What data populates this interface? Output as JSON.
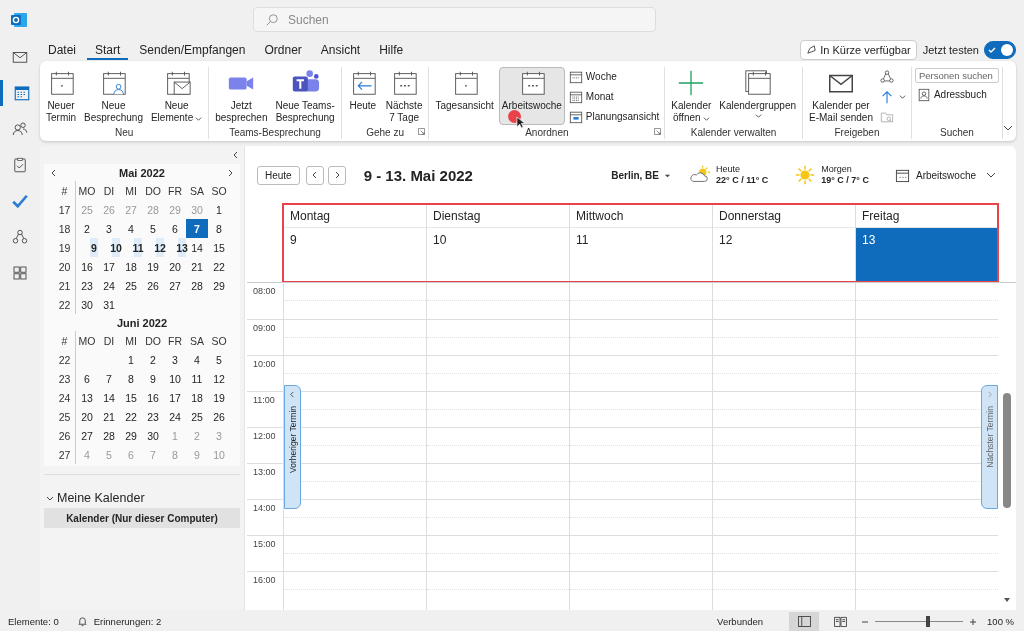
{
  "search": {
    "placeholder": "Suchen"
  },
  "nav_rail": [
    {
      "selected": false
    },
    {
      "selected": true
    },
    {
      "selected": false
    },
    {
      "selected": false
    },
    {
      "selected": false
    },
    {
      "selected": false
    },
    {
      "selected": false
    }
  ],
  "menu_tabs": [
    {
      "label": "Datei",
      "selected": false
    },
    {
      "label": "Start",
      "selected": true
    },
    {
      "label": "Senden/Empfangen",
      "selected": false
    },
    {
      "label": "Ordner",
      "selected": false
    },
    {
      "label": "Ansicht",
      "selected": false
    },
    {
      "label": "Hilfe",
      "selected": false
    }
  ],
  "coming_soon": {
    "label": "In Kürze verfügbar"
  },
  "try_now": {
    "label": "Jetzt testen",
    "on": true
  },
  "ribbon": [
    {
      "label": "Neu",
      "items": [
        {
          "kind": "large",
          "lines": [
            "Neuer",
            "Termin"
          ],
          "dropdown": false
        },
        {
          "kind": "large",
          "lines": [
            "Neue",
            "Besprechung"
          ],
          "dropdown": false
        },
        {
          "kind": "large",
          "lines": [
            "Neue",
            "Elemente"
          ],
          "dropdown": true
        }
      ]
    },
    {
      "label": "Teams-Besprechung",
      "items": [
        {
          "kind": "large",
          "lines": [
            "Jetzt",
            "besprechen"
          ]
        },
        {
          "kind": "large",
          "lines": [
            "Neue Teams-",
            "Besprechung"
          ]
        }
      ]
    },
    {
      "label": "Gehe zu",
      "launcher": true,
      "items": [
        {
          "kind": "large",
          "lines": [
            "Heute"
          ]
        },
        {
          "kind": "large",
          "lines": [
            "Nächste",
            "7 Tage"
          ]
        }
      ]
    },
    {
      "label": "Anordnen",
      "launcher": true,
      "items": [
        {
          "kind": "large",
          "lines": [
            "Tagesansicht"
          ],
          "selected": false
        },
        {
          "kind": "large",
          "lines": [
            "Arbeitswoche"
          ],
          "selected": true
        },
        {
          "kind": "small",
          "lines": [
            "Woche"
          ],
          "selected": false
        },
        {
          "kind": "small",
          "lines": [
            "Monat"
          ],
          "selected": false
        },
        {
          "kind": "small",
          "lines": [
            "Planungsansicht"
          ],
          "selected": false
        }
      ]
    },
    {
      "label": "Kalender verwalten",
      "items": [
        {
          "kind": "large",
          "lines": [
            "Kalender",
            "öffnen"
          ],
          "dropdown": true
        },
        {
          "kind": "large",
          "lines": [
            "Kalendergruppen"
          ],
          "dropdown": true
        }
      ]
    },
    {
      "label": "Freigeben",
      "items": [
        {
          "kind": "large",
          "lines": [
            "Kalender per",
            "E-Mail senden"
          ]
        },
        {
          "kind": "icon",
          "dropdown": false
        },
        {
          "kind": "icon",
          "dropdown": true
        },
        {
          "kind": "icon",
          "dropdown": false
        }
      ]
    },
    {
      "label": "Suchen",
      "items": [
        {
          "kind": "field",
          "placeholder": "Personen suchen"
        },
        {
          "kind": "small",
          "lines": [
            "Adressbuch"
          ]
        }
      ]
    }
  ],
  "mini_calendars": [
    {
      "title": "Mai 2022",
      "week_header": "#",
      "weekdays": [
        "MO",
        "DI",
        "MI",
        "DO",
        "FR",
        "SA",
        "SO"
      ],
      "weeks": [
        {
          "week": "17",
          "days": [
            {
              "text": "25",
              "muted": true,
              "selected": false,
              "today": false
            },
            {
              "text": "26",
              "muted": true,
              "selected": false,
              "today": false
            },
            {
              "text": "27",
              "muted": true,
              "selected": false,
              "today": false
            },
            {
              "text": "28",
              "muted": true,
              "selected": false,
              "today": false
            },
            {
              "text": "29",
              "muted": true,
              "selected": false,
              "today": false
            },
            {
              "text": "30",
              "muted": true,
              "selected": false,
              "today": false
            },
            {
              "text": "1",
              "muted": false,
              "selected": false,
              "today": false
            }
          ]
        },
        {
          "week": "18",
          "days": [
            {
              "text": "2",
              "muted": false,
              "selected": false,
              "today": false
            },
            {
              "text": "3",
              "muted": false,
              "selected": false,
              "today": false
            },
            {
              "text": "4",
              "muted": false,
              "selected": false,
              "today": false
            },
            {
              "text": "5",
              "muted": false,
              "selected": false,
              "today": false
            },
            {
              "text": "6",
              "muted": false,
              "selected": false,
              "today": false
            },
            {
              "text": "7",
              "muted": false,
              "selected": false,
              "today": true
            },
            {
              "text": "8",
              "muted": false,
              "selected": false,
              "today": false
            }
          ]
        },
        {
          "week": "19",
          "days": [
            {
              "text": "9",
              "muted": false,
              "selected": true,
              "today": false
            },
            {
              "text": "10",
              "muted": false,
              "selected": true,
              "today": false
            },
            {
              "text": "11",
              "muted": false,
              "selected": true,
              "today": false
            },
            {
              "text": "12",
              "muted": false,
              "selected": true,
              "today": false
            },
            {
              "text": "13",
              "muted": false,
              "selected": true,
              "today": false
            },
            {
              "text": "14",
              "muted": false,
              "selected": false,
              "today": false
            },
            {
              "text": "15",
              "muted": false,
              "selected": false,
              "today": false
            }
          ]
        },
        {
          "week": "20",
          "days": [
            {
              "text": "16",
              "muted": false,
              "selected": false,
              "today": false
            },
            {
              "text": "17",
              "muted": false,
              "selected": false,
              "today": false
            },
            {
              "text": "18",
              "muted": false,
              "selected": false,
              "today": false
            },
            {
              "text": "19",
              "muted": false,
              "selected": false,
              "today": false
            },
            {
              "text": "20",
              "muted": false,
              "selected": false,
              "today": false
            },
            {
              "text": "21",
              "muted": false,
              "selected": false,
              "today": false
            },
            {
              "text": "22",
              "muted": false,
              "selected": false,
              "today": false
            }
          ]
        },
        {
          "week": "21",
          "days": [
            {
              "text": "23",
              "muted": false,
              "selected": false,
              "today": false
            },
            {
              "text": "24",
              "muted": false,
              "selected": false,
              "today": false
            },
            {
              "text": "25",
              "muted": false,
              "selected": false,
              "today": false
            },
            {
              "text": "26",
              "muted": false,
              "selected": false,
              "today": false
            },
            {
              "text": "27",
              "muted": false,
              "selected": false,
              "today": false
            },
            {
              "text": "28",
              "muted": false,
              "selected": false,
              "today": false
            },
            {
              "text": "29",
              "muted": false,
              "selected": false,
              "today": false
            }
          ]
        },
        {
          "week": "22",
          "days": [
            {
              "text": "30",
              "muted": false,
              "selected": false,
              "today": false
            },
            {
              "text": "31",
              "muted": false,
              "selected": false,
              "today": false
            }
          ]
        }
      ]
    },
    {
      "title": "Juni 2022",
      "week_header": "#",
      "weekdays": [
        "MO",
        "DI",
        "MI",
        "DO",
        "FR",
        "SA",
        "SO"
      ],
      "weeks": [
        {
          "week": "22",
          "days": [
            {
              "text": "1",
              "muted": false,
              "selected": false,
              "today": false
            },
            {
              "text": "2",
              "muted": false,
              "selected": false,
              "today": false
            },
            {
              "text": "3",
              "muted": false,
              "selected": false,
              "today": false
            },
            {
              "text": "4",
              "muted": false,
              "selected": false,
              "today": false
            },
            {
              "text": "5",
              "muted": false,
              "selected": false,
              "today": false
            }
          ]
        },
        {
          "week": "23",
          "days": [
            {
              "text": "6",
              "muted": false,
              "selected": false,
              "today": false
            },
            {
              "text": "7",
              "muted": false,
              "selected": false,
              "today": false
            },
            {
              "text": "8",
              "muted": false,
              "selected": false,
              "today": false
            },
            {
              "text": "9",
              "muted": false,
              "selected": false,
              "today": false
            },
            {
              "text": "10",
              "muted": false,
              "selected": false,
              "today": false
            },
            {
              "text": "11",
              "muted": false,
              "selected": false,
              "today": false
            },
            {
              "text": "12",
              "muted": false,
              "selected": false,
              "today": false
            }
          ]
        },
        {
          "week": "24",
          "days": [
            {
              "text": "13",
              "muted": false,
              "selected": false,
              "today": false
            },
            {
              "text": "14",
              "muted": false,
              "selected": false,
              "today": false
            },
            {
              "text": "15",
              "muted": false,
              "selected": false,
              "today": false
            },
            {
              "text": "16",
              "muted": false,
              "selected": false,
              "today": false
            },
            {
              "text": "17",
              "muted": false,
              "selected": false,
              "today": false
            },
            {
              "text": "18",
              "muted": false,
              "selected": false,
              "today": false
            },
            {
              "text": "19",
              "muted": false,
              "selected": false,
              "today": false
            }
          ]
        },
        {
          "week": "25",
          "days": [
            {
              "text": "20",
              "muted": false,
              "selected": false,
              "today": false
            },
            {
              "text": "21",
              "muted": false,
              "selected": false,
              "today": false
            },
            {
              "text": "22",
              "muted": false,
              "selected": false,
              "today": false
            },
            {
              "text": "23",
              "muted": false,
              "selected": false,
              "today": false
            },
            {
              "text": "24",
              "muted": false,
              "selected": false,
              "today": false
            },
            {
              "text": "25",
              "muted": false,
              "selected": false,
              "today": false
            },
            {
              "text": "26",
              "muted": false,
              "selected": false,
              "today": false
            }
          ]
        },
        {
          "week": "26",
          "days": [
            {
              "text": "27",
              "muted": false,
              "selected": false,
              "today": false
            },
            {
              "text": "28",
              "muted": false,
              "selected": false,
              "today": false
            },
            {
              "text": "29",
              "muted": false,
              "selected": false,
              "today": false
            },
            {
              "text": "30",
              "muted": false,
              "selected": false,
              "today": false
            },
            {
              "text": "1",
              "muted": true,
              "selected": false,
              "today": false
            },
            {
              "text": "2",
              "muted": true,
              "selected": false,
              "today": false
            },
            {
              "text": "3",
              "muted": true,
              "selected": false,
              "today": false
            }
          ]
        },
        {
          "week": "27",
          "days": [
            {
              "text": "4",
              "muted": true,
              "selected": false,
              "today": false
            },
            {
              "text": "5",
              "muted": true,
              "selected": false,
              "today": false
            },
            {
              "text": "6",
              "muted": true,
              "selected": false,
              "today": false
            },
            {
              "text": "7",
              "muted": true,
              "selected": false,
              "today": false
            },
            {
              "text": "8",
              "muted": true,
              "selected": false,
              "today": false
            },
            {
              "text": "9",
              "muted": true,
              "selected": false,
              "today": false
            },
            {
              "text": "10",
              "muted": true,
              "selected": false,
              "today": false
            }
          ]
        }
      ]
    }
  ],
  "my_calendars": {
    "label": "Meine Kalender",
    "expanded": true,
    "items": [
      {
        "label": "Kalender (Nur dieser Computer)",
        "selected": true
      }
    ]
  },
  "toolbar": {
    "today": "Heute",
    "range": "9 - 13. Mai 2022",
    "location": "Berlin, BE",
    "weather": [
      {
        "kind": "partly_cloudy",
        "day": "Heute",
        "temps": "22° C / 11° C"
      },
      {
        "kind": "sunny",
        "day": "Morgen",
        "temps": "19° C / 7° C"
      }
    ],
    "view": "Arbeitswoche"
  },
  "days": [
    {
      "name": "Montag",
      "date": "9",
      "selected": false
    },
    {
      "name": "Dienstag",
      "date": "10",
      "selected": false
    },
    {
      "name": "Mittwoch",
      "date": "11",
      "selected": false
    },
    {
      "name": "Donnerstag",
      "date": "12",
      "selected": false
    },
    {
      "name": "Freitag",
      "date": "13",
      "selected": true
    }
  ],
  "hours": [
    "08:00",
    "09:00",
    "10:00",
    "11:00",
    "12:00",
    "13:00",
    "14:00",
    "15:00",
    "16:00"
  ],
  "side_tabs": {
    "previous": "Vorheriger Termin",
    "next": "Nächster Termin"
  },
  "status_bar": {
    "items": "Elemente: 0",
    "reminders": "Erinnerungen: 2",
    "connection": "Verbunden",
    "views": [
      {
        "selected": true
      },
      {
        "selected": false
      }
    ],
    "zoom": {
      "level": 0.6
    },
    "zoom_text": "100 %"
  }
}
